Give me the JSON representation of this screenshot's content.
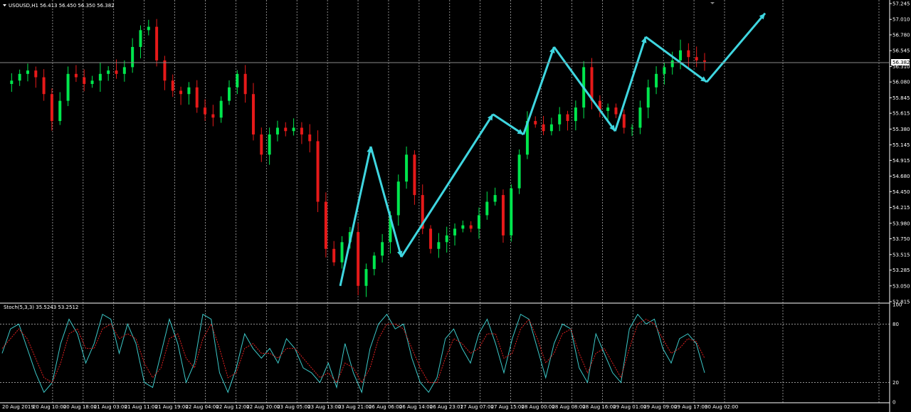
{
  "chart_header": {
    "symbol": "USOUSD,H1",
    "ohlc": "56.413 56.450 56.350 56.382"
  },
  "stoch_header": "Stoch(5,3,3) 35.5243 53.2512",
  "current_price": "56.382",
  "colors": {
    "bull": "#00e64d",
    "bear": "#e61919",
    "arrow": "#3fd6e0",
    "stoch_main": "#3cc8c8",
    "stoch_signal": "#e02020",
    "grid": "#bfbfbf"
  },
  "chart_data": [
    {
      "type": "candlestick",
      "title": "USOUSD,H1",
      "ylim": [
        52.815,
        57.245
      ],
      "y_ticks": [
        "57.245",
        "57.010",
        "56.780",
        "56.545",
        "56.310",
        "56.080",
        "55.845",
        "55.615",
        "55.380",
        "55.145",
        "54.915",
        "54.680",
        "54.450",
        "54.215",
        "53.980",
        "53.750",
        "53.515",
        "53.285",
        "53.050",
        "52.815"
      ],
      "x_labels": [
        "20 Aug 2019",
        "20 Aug 10:00",
        "20 Aug 18:00",
        "21 Aug 03:00",
        "21 Aug 11:00",
        "21 Aug 19:00",
        "22 Aug 04:00",
        "22 Aug 12:00",
        "22 Aug 20:00",
        "23 Aug 05:00",
        "23 Aug 13:00",
        "23 Aug 21:00",
        "26 Aug 06:00",
        "26 Aug 14:00",
        "26 Aug 23:01",
        "27 Aug 07:00",
        "27 Aug 15:00",
        "28 Aug 00:00",
        "28 Aug 08:00",
        "28 Aug 16:00",
        "29 Aug 01:00",
        "29 Aug 09:00",
        "29 Aug 17:00",
        "30 Aug 02:00"
      ],
      "close_path": [
        56.05,
        56.1,
        56.2,
        56.25,
        56.15,
        55.9,
        55.5,
        55.8,
        56.2,
        56.15,
        56.05,
        56.1,
        56.2,
        56.25,
        56.2,
        56.3,
        56.6,
        56.85,
        56.9,
        56.4,
        56.1,
        55.95,
        55.9,
        56.0,
        55.7,
        55.6,
        55.55,
        55.8,
        56.0,
        56.2,
        55.9,
        55.3,
        55.0,
        55.3,
        55.4,
        55.35,
        55.4,
        55.3,
        55.2,
        54.3,
        53.6,
        53.4,
        53.7,
        53.85,
        53.05,
        53.3,
        53.5,
        53.7,
        54.1,
        54.6,
        55.0,
        54.4,
        53.9,
        53.6,
        53.7,
        53.8,
        53.9,
        53.95,
        53.9,
        54.1,
        54.3,
        54.4,
        53.8,
        54.5,
        55.0,
        55.5,
        55.45,
        55.35,
        55.45,
        55.6,
        55.5,
        55.7,
        56.3,
        55.8,
        55.65,
        55.7,
        55.6,
        55.4,
        55.4,
        55.7,
        56.0,
        56.2,
        56.3,
        56.4,
        56.55,
        56.45,
        56.4,
        56.38
      ],
      "annotation_arrows": [
        {
          "from": [
            "23 Aug 21:00",
            53.05
          ],
          "to": [
            "26 Aug 06:00",
            55.12
          ]
        },
        {
          "from": [
            "26 Aug 06:00",
            55.12
          ],
          "to": [
            "26 Aug 14:00",
            53.48
          ]
        },
        {
          "from": [
            "26 Aug 14:00",
            53.48
          ],
          "to": [
            "27 Aug 15:00",
            55.6
          ]
        },
        {
          "from": [
            "27 Aug 15:00",
            55.6
          ],
          "to": [
            "28 Aug 00:00",
            55.3
          ]
        },
        {
          "from": [
            "28 Aug 00:00",
            55.3
          ],
          "to": [
            "28 Aug 08:00",
            56.6
          ]
        },
        {
          "from": [
            "28 Aug 08:00",
            56.6
          ],
          "to": [
            "29 Aug 01:00",
            55.35
          ]
        },
        {
          "from": [
            "29 Aug 01:00",
            55.35
          ],
          "to": [
            "29 Aug 09:00",
            56.75
          ]
        },
        {
          "from": [
            "29 Aug 09:00",
            56.75
          ],
          "to": [
            "30 Aug 02:00",
            56.08
          ]
        },
        {
          "from": [
            "30 Aug 02:00",
            56.08
          ],
          "to": [
            "30 Aug 02:00+",
            57.1
          ]
        }
      ]
    },
    {
      "type": "line",
      "title": "Stoch(5,3,3) 35.5243 53.2512",
      "ylim": [
        0,
        100
      ],
      "y_ticks": [
        "100",
        "80",
        "20",
        "0"
      ],
      "series": [
        {
          "name": "main",
          "values": [
            50,
            75,
            80,
            55,
            30,
            10,
            20,
            60,
            85,
            70,
            40,
            60,
            90,
            85,
            50,
            80,
            60,
            20,
            15,
            50,
            85,
            60,
            20,
            40,
            90,
            85,
            30,
            10,
            35,
            70,
            55,
            45,
            55,
            40,
            65,
            55,
            35,
            30,
            20,
            40,
            15,
            60,
            30,
            10,
            55,
            80,
            90,
            75,
            80,
            45,
            20,
            10,
            25,
            65,
            75,
            55,
            40,
            70,
            85,
            60,
            30,
            65,
            90,
            85,
            55,
            25,
            60,
            80,
            75,
            35,
            20,
            70,
            50,
            30,
            20,
            75,
            90,
            80,
            85,
            55,
            40,
            65,
            70,
            60,
            30
          ]
        },
        {
          "name": "signal",
          "values": [
            55,
            65,
            75,
            65,
            45,
            25,
            20,
            40,
            70,
            75,
            55,
            55,
            75,
            80,
            65,
            70,
            65,
            40,
            25,
            35,
            65,
            70,
            45,
            35,
            65,
            80,
            55,
            25,
            30,
            55,
            60,
            50,
            50,
            45,
            55,
            55,
            45,
            35,
            25,
            30,
            20,
            40,
            35,
            20,
            35,
            65,
            80,
            80,
            75,
            55,
            35,
            20,
            20,
            45,
            65,
            60,
            50,
            55,
            70,
            70,
            45,
            50,
            75,
            85,
            65,
            40,
            50,
            70,
            75,
            50,
            30,
            50,
            55,
            40,
            25,
            55,
            80,
            85,
            80,
            65,
            50,
            55,
            65,
            62,
            45
          ]
        }
      ]
    }
  ]
}
